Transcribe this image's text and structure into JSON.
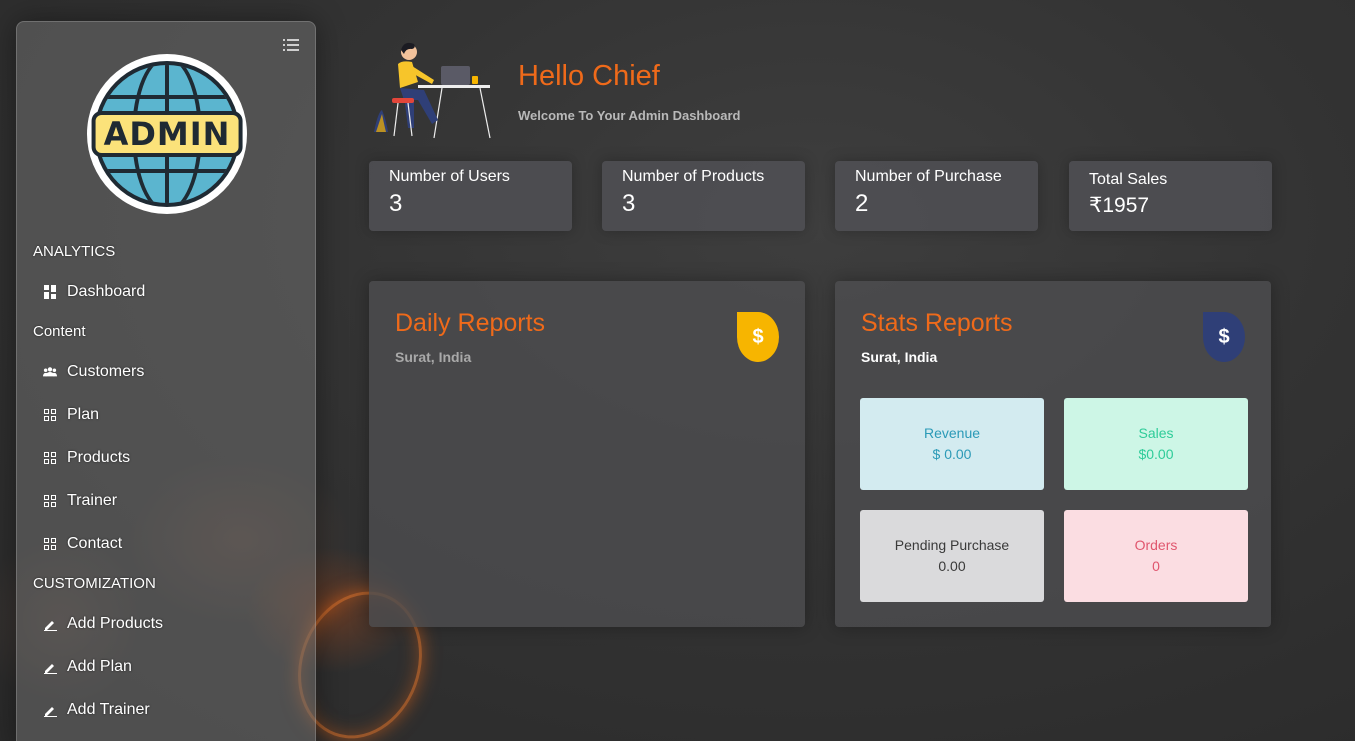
{
  "sidebar": {
    "logo_text": "ADMIN",
    "sections": {
      "analytics": "ANALYTICS",
      "content": "Content",
      "customization": "CUSTOMIZATION"
    },
    "items": [
      {
        "label": "Dashboard",
        "icon": "dashboard-icon"
      },
      {
        "label": "Customers",
        "icon": "users-icon"
      },
      {
        "label": "Plan",
        "icon": "grid-icon"
      },
      {
        "label": "Products",
        "icon": "grid-icon"
      },
      {
        "label": "Trainer",
        "icon": "grid-icon"
      },
      {
        "label": "Contact",
        "icon": "grid-icon"
      },
      {
        "label": "Add Products",
        "icon": "pencil-icon"
      },
      {
        "label": "Add Plan",
        "icon": "pencil-icon"
      },
      {
        "label": "Add Trainer",
        "icon": "pencil-icon"
      }
    ]
  },
  "header": {
    "greeting": "Hello Chief",
    "subtitle": "Welcome To Your Admin Dashboard"
  },
  "stats": [
    {
      "label": "Number of Users",
      "value": "3"
    },
    {
      "label": "Number of Products",
      "value": "3"
    },
    {
      "label": "Number of Purchase",
      "value": "2"
    },
    {
      "label": "Total Sales",
      "value": "₹1957"
    }
  ],
  "daily_report": {
    "title": "Daily Reports",
    "location": "Surat, India",
    "icon": "dollar-icon"
  },
  "stats_report": {
    "title": "Stats Reports",
    "location": "Surat, India",
    "icon": "dollar-icon",
    "tiles": [
      {
        "label": "Revenue",
        "value": "$ 0.00",
        "bg": "#d3ebf0",
        "color": "#2b9ab7"
      },
      {
        "label": "Sales",
        "value": "$0.00",
        "bg": "#cdf6e6",
        "color": "#2ecc99"
      },
      {
        "label": "Pending Purchase",
        "value": "0.00",
        "bg": "#dadadc",
        "color": "#3a3a3a"
      },
      {
        "label": "Orders",
        "value": "0",
        "bg": "#fbdde2",
        "color": "#e0566e"
      }
    ]
  },
  "colors": {
    "accent": "#ef6a1a",
    "drop_yellow": "#f7b500",
    "drop_blue": "#2f3f77"
  }
}
